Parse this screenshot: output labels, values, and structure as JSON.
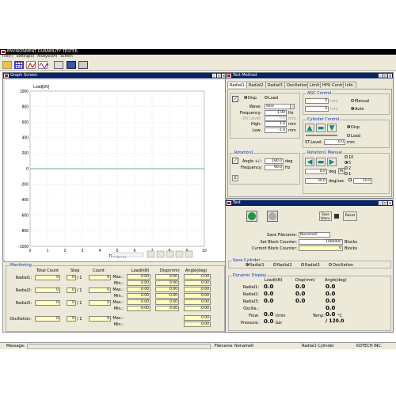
{
  "app": {
    "title": "ENVIRONMENT DURABILITY TESTER"
  },
  "menu": [
    "File(F)",
    "Setting(S)",
    "Analysis(A)",
    "Screen"
  ],
  "graph": {
    "title": "Graph Screen",
    "chart_data": {
      "type": "line",
      "ylabel": "Load[kN]",
      "xlabel": "Time[sec]",
      "xlim": [
        0,
        10
      ],
      "ylim": [
        -1000,
        1000
      ],
      "xticks": [
        0,
        1,
        2,
        3,
        4,
        5,
        6,
        7,
        8,
        9,
        10
      ],
      "yticks": [
        1000,
        800,
        600,
        400,
        200,
        0,
        -200,
        -400,
        -600,
        -800,
        -1000
      ],
      "series": [
        {
          "x": [
            0,
            10
          ],
          "y": [
            0,
            0
          ],
          "color": "#2a9d8f"
        }
      ],
      "grid": true
    }
  },
  "monitoring": {
    "title": "Monitoring",
    "headers": {
      "total": "Total Count",
      "step": "Step",
      "count": "Count",
      "load": "Load(kN)",
      "disp": "Disp(mm)",
      "angle": "Angle(deg)"
    },
    "rows": [
      {
        "label": "Radial1:",
        "total": "0",
        "step": "0",
        "steptotal": "/ 1",
        "count": "0"
      },
      {
        "label": "Radial2:",
        "total": "0",
        "step": "0",
        "steptotal": "/ 1",
        "count": "0"
      },
      {
        "label": "Radial3:",
        "total": "0",
        "step": "0",
        "steptotal": "/ 1",
        "count": "0"
      },
      {
        "label": "Oscillation:",
        "total": "0",
        "step": "0",
        "steptotal": "/ 1",
        "count": "0"
      }
    ],
    "minmax": [
      {
        "label": "Max.:",
        "load": "0.00",
        "disp": "0.00",
        "angle": "0.00"
      },
      {
        "label": "Min.:",
        "load": "0.00",
        "disp": "0.00",
        "angle": "0.00"
      },
      {
        "label": "Max.:",
        "load": "0.00",
        "disp": "0.00",
        "angle": "0.00"
      },
      {
        "label": "Min.:",
        "load": "0.00",
        "disp": "0.00",
        "angle": "0.00"
      },
      {
        "label": "Max.:",
        "load": "0.00",
        "disp": "0.00",
        "angle": "0.00"
      },
      {
        "label": "Min.:",
        "load": "0.00",
        "disp": "0.00",
        "angle": "0.00"
      },
      {
        "label": "Max.:",
        "load": "",
        "disp": "",
        "angle": "0.00"
      },
      {
        "label": "Min.:",
        "load": "",
        "disp": "",
        "angle": "0.00"
      }
    ]
  },
  "testmethod": {
    "title": "Test Method",
    "tabs": [
      "Radial1",
      "Radial2",
      "Radial3",
      "Oscillation",
      "Limit",
      "HPU Control",
      "Info."
    ],
    "disp": "Disp",
    "load": "Load",
    "wave_label": "Wave:",
    "wave_value": "Sine",
    "freq_label": "Frequency:",
    "freq_value": "1.00",
    "freq_unit": "Hz",
    "dvlevel_label": "DV Level:",
    "dvlevel_value": "0.0",
    "dvlevel_unit": "mm",
    "high_label": "High:",
    "high_value": "1.0",
    "high_unit": "mm",
    "low_label": "Low:",
    "low_value": "-1.0",
    "low_unit": "mm",
    "agc": {
      "title": "AGC Control",
      "manual": "Manual",
      "auto": "Auto",
      "v1": "0",
      "v2": "0",
      "unit": "mm"
    },
    "cyl": {
      "title": "Cylinder Control",
      "disp": "Disp",
      "load": "Load",
      "stlevel_label": "ST.Level:",
      "stlevel_value": "0.0",
      "stlevel_unit": "mm"
    },
    "rot1": {
      "title": "Rotation1",
      "angle_label": "Angle +/-:",
      "angle_value": "180.0",
      "angle_unit": "deg",
      "freq_label": "Frequency:",
      "freq_value": "90.0",
      "freq_unit": "Hz"
    },
    "rot1m": {
      "title": "Rotation1 Manual",
      "r10": "10",
      "r5": "5",
      "r2": "2",
      "r1": "1",
      "deg_value": "0.0",
      "deg_unit": "deg",
      "m_btn": "M",
      "speed_value": "30.0",
      "speed_unit": "deg/sec",
      "speed2": "10.0"
    }
  },
  "test": {
    "title": "Test",
    "saveinterv": "Save Interv.",
    "reset": "Reset",
    "savefile_label": "Save Filename:",
    "savefile_value": "Noname0",
    "setblock_label": "Set Block Counter:",
    "setblock_value": "1000000",
    "setblock_unit": "Blocks",
    "curblock_label": "Current Block Counter:",
    "curblock_value": "0",
    "curblock_unit": "Blocks",
    "savecyl": {
      "title": "Save Cylinder",
      "items": [
        "Radial1",
        "Radial2",
        "Radial3",
        "Oscillation"
      ]
    },
    "dyn": {
      "title": "Dynamic Display",
      "headers": {
        "load": "Load(kN)",
        "disp": "Disp(mm)",
        "angle": "Angle(deg)"
      },
      "rows": [
        {
          "label": "Radial1:",
          "load": "0.0",
          "disp": "0.0",
          "angle": "0.0"
        },
        {
          "label": "Radial2:",
          "load": "0.0",
          "disp": "0.0",
          "angle": "0.0"
        },
        {
          "label": "Radial3:",
          "load": "0.0",
          "disp": "0.0",
          "angle": "0.0"
        },
        {
          "label": "Oscilla.:",
          "load": "",
          "disp": "",
          "angle": "0.0"
        }
      ],
      "flow_label": "Flow:",
      "flow_value": "0.0",
      "flow_unit": "l/min",
      "temp_label": "Temp:",
      "temp_value": "0.0",
      "temp_unit": "°C",
      "pres_label": "Pressure:",
      "pres_value": "0.0",
      "pres_unit": "bar",
      "pres_max": "/ 120.0"
    }
  },
  "status": {
    "message_label": "Message:",
    "filename_label": "Filename",
    "filename_value": "Noname0",
    "cyl": "Radial1 Cylinder",
    "company": "KDTECH INC."
  }
}
